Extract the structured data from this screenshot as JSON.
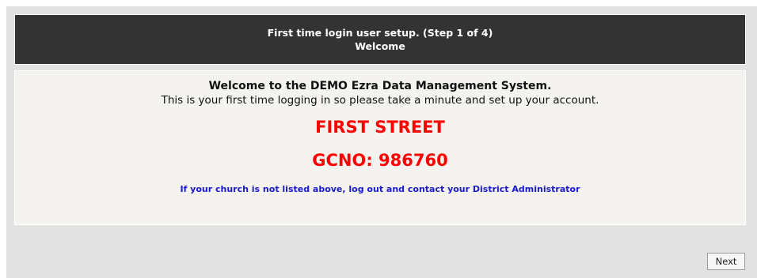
{
  "header": {
    "line1": "First time login user setup. (Step 1 of 4)",
    "line2": "Welcome"
  },
  "content": {
    "title": "Welcome to the DEMO Ezra Data Management System.",
    "subtitle": "This is your first time logging in so please take a minute and set up your account.",
    "church_name": "FIRST STREET",
    "gcno": "GCNO: 986760",
    "notice": "If your church is not listed above, log out and contact your District Administrator"
  },
  "actions": {
    "next_label": "Next"
  },
  "colors": {
    "header_bg": "#333333",
    "panel_bg": "#f4f3ef",
    "page_bg": "#e2e2e2",
    "alert_red": "#ff0000",
    "notice_blue": "#1a1acc"
  }
}
